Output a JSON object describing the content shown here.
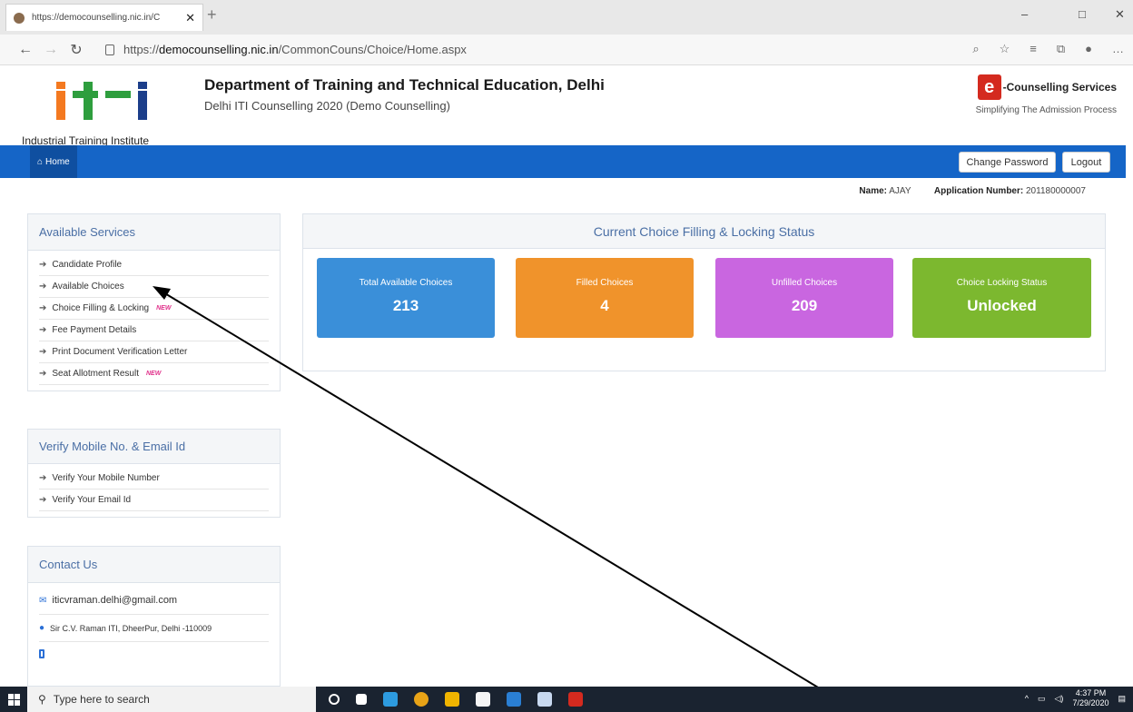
{
  "browser": {
    "tab_title": "https://democounselling.nic.in/C",
    "tab_close": "✕",
    "new_tab": "+",
    "url_prefix": "https://",
    "url_domain": "democounselling.nic.in",
    "url_path": "/CommonCouns/Choice/Home.aspx",
    "win_min": "–",
    "win_max": "□",
    "win_close": "✕"
  },
  "header": {
    "logo_text": "Industrial Training Institute",
    "department": "Department of Training and Technical Education, Delhi",
    "subtitle": "Delhi ITI Counselling 2020 (Demo Counselling)",
    "ec_letter": "e",
    "ec_title": "-Counselling Services",
    "ec_tagline": "Simplifying The Admission Process"
  },
  "navbar": {
    "home": "Home",
    "change_password": "Change Password",
    "logout": "Logout"
  },
  "user": {
    "name_label": "Name:",
    "name_value": "AJAY",
    "app_label": "Application Number:",
    "app_value": "201180000007"
  },
  "services": {
    "title": "Available Services",
    "items": [
      {
        "label": "Candidate Profile",
        "new": ""
      },
      {
        "label": "Available Choices",
        "new": ""
      },
      {
        "label": "Choice Filling & Locking",
        "new": "NEW"
      },
      {
        "label": "Fee Payment Details",
        "new": ""
      },
      {
        "label": "Print Document Verification Letter",
        "new": ""
      },
      {
        "label": "Seat Allotment Result",
        "new": "NEW"
      }
    ]
  },
  "verify": {
    "title": "Verify Mobile No. & Email Id",
    "items": [
      "Verify Your Mobile Number",
      "Verify Your Email Id"
    ]
  },
  "contact": {
    "title": "Contact Us",
    "email": "iticvraman.delhi@gmail.com",
    "address": "Sir C.V. Raman ITI, DheerPur, Delhi -110009"
  },
  "status": {
    "title": "Current Choice Filling & Locking Status",
    "cards": [
      {
        "label": "Total Available Choices",
        "value": "213",
        "color": "#3a8fd9"
      },
      {
        "label": "Filled Choices",
        "value": "4",
        "color": "#f0932b"
      },
      {
        "label": "Unfilled Choices",
        "value": "209",
        "color": "#c966e0"
      },
      {
        "label": "Choice Locking Status",
        "value": "Unlocked",
        "color": "#7cb82f"
      }
    ]
  },
  "taskbar": {
    "search_placeholder": "Type here to search",
    "time": "4:37 PM",
    "date": "7/29/2020"
  }
}
